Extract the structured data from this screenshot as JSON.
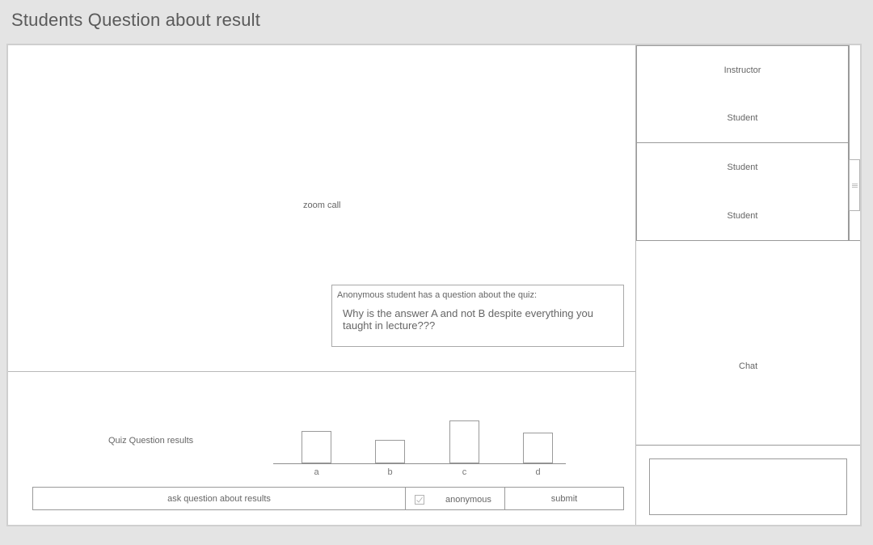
{
  "page": {
    "title": "Students Question about result"
  },
  "video": {
    "label": "zoom call"
  },
  "question_popup": {
    "heading": "Anonymous student has a question about the quiz:",
    "text": "Why is the answer A and not B despite everything you taught in lecture???"
  },
  "quiz_results": {
    "label": "Quiz Question results"
  },
  "chart_data": {
    "type": "bar",
    "categories": [
      "a",
      "b",
      "c",
      "d"
    ],
    "values": [
      40,
      29,
      53,
      38
    ],
    "title": "",
    "xlabel": "",
    "ylabel": "",
    "ylim": [
      0,
      60
    ],
    "grid": false
  },
  "question_form": {
    "ask_label": "ask question about results",
    "anonymous_label": "anonymous",
    "anonymous_checked": true,
    "submit_label": "submit"
  },
  "participants": [
    {
      "label": "Instructor"
    },
    {
      "label": "Student"
    },
    {
      "label": "Student"
    },
    {
      "label": "Student"
    }
  ],
  "chat": {
    "label": "Chat"
  }
}
